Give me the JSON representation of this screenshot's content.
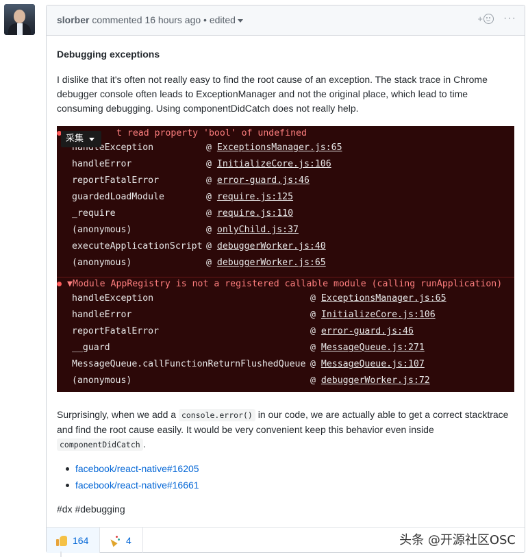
{
  "comment": {
    "author": "slorber",
    "action": "commented",
    "time": "16 hours ago",
    "separator": "•",
    "edited_label": "edited",
    "heading": "Debugging exceptions",
    "paragraph1": "I dislike that it's often not really easy to find the root cause of an exception. The stack trace in Chrome debugger console often leads to ExceptionManager and not the original place, which lead to time consuming debugging. Using componentDidCatch does not really help.",
    "paragraph2_before": "Surprisingly, when we add a",
    "paragraph2_code": "console.error()",
    "paragraph2_after": "in our code, we are actually able to get a correct stacktrace and find the root cause easily. It would be very convenient keep this behavior even inside",
    "paragraph2_code2": "componentDidCatch",
    "paragraph2_end": ".",
    "links": [
      "facebook/react-native#16205",
      "facebook/react-native#16661"
    ],
    "tags": "#dx #debugging"
  },
  "header_actions": {
    "add_reaction_plus": "+",
    "more_icon": "···"
  },
  "console": {
    "overlay_button": "采集",
    "error1": "t read property 'bool' of undefined",
    "error1_rows": [
      {
        "fn": "handleException",
        "file": "ExceptionsManager.js:65"
      },
      {
        "fn": "handleError",
        "file": "InitializeCore.js:106"
      },
      {
        "fn": "reportFatalError",
        "file": "error-guard.js:46"
      },
      {
        "fn": "guardedLoadModule",
        "file": "require.js:125"
      },
      {
        "fn": "_require",
        "file": "require.js:110"
      },
      {
        "fn": "(anonymous)",
        "file": "onlyChild.js:37"
      },
      {
        "fn": "executeApplicationScript",
        "file": "debuggerWorker.js:40"
      },
      {
        "fn": "(anonymous)",
        "file": "debuggerWorker.js:65"
      }
    ],
    "error2": "▼Module AppRegistry is not a registered callable module (calling runApplication)",
    "error2_rows": [
      {
        "fn": "handleException",
        "file": "ExceptionsManager.js:65"
      },
      {
        "fn": "handleError",
        "file": "InitializeCore.js:106"
      },
      {
        "fn": "reportFatalError",
        "file": "error-guard.js:46"
      },
      {
        "fn": "__guard",
        "file": "MessageQueue.js:271"
      },
      {
        "fn": "MessageQueue.callFunctionReturnFlushedQueue",
        "file": "MessageQueue.js:107"
      },
      {
        "fn": "(anonymous)",
        "file": "debuggerWorker.js:72"
      }
    ],
    "at_symbol": "@"
  },
  "reactions": [
    {
      "icon": "thumbs-up-icon",
      "count": "164"
    },
    {
      "icon": "hooray-icon",
      "count": "4"
    }
  ],
  "watermark": "头条 @开源社区OSC"
}
